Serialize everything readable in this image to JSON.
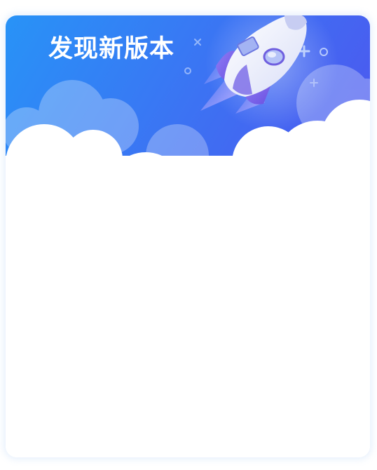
{
  "dialog": {
    "title": "发现新版本"
  },
  "decor": {
    "illustration": "rocket-icon",
    "clouds": "clouds-illustration",
    "sparkles": [
      "plus-sparkle-icon",
      "circle-sparkle-icon",
      "cross-sparkle-icon"
    ]
  },
  "colors": {
    "banner_start": "#2a8cf8",
    "banner_end": "#4760f0",
    "cloud": "#ffffff",
    "title": "#ffffff"
  }
}
